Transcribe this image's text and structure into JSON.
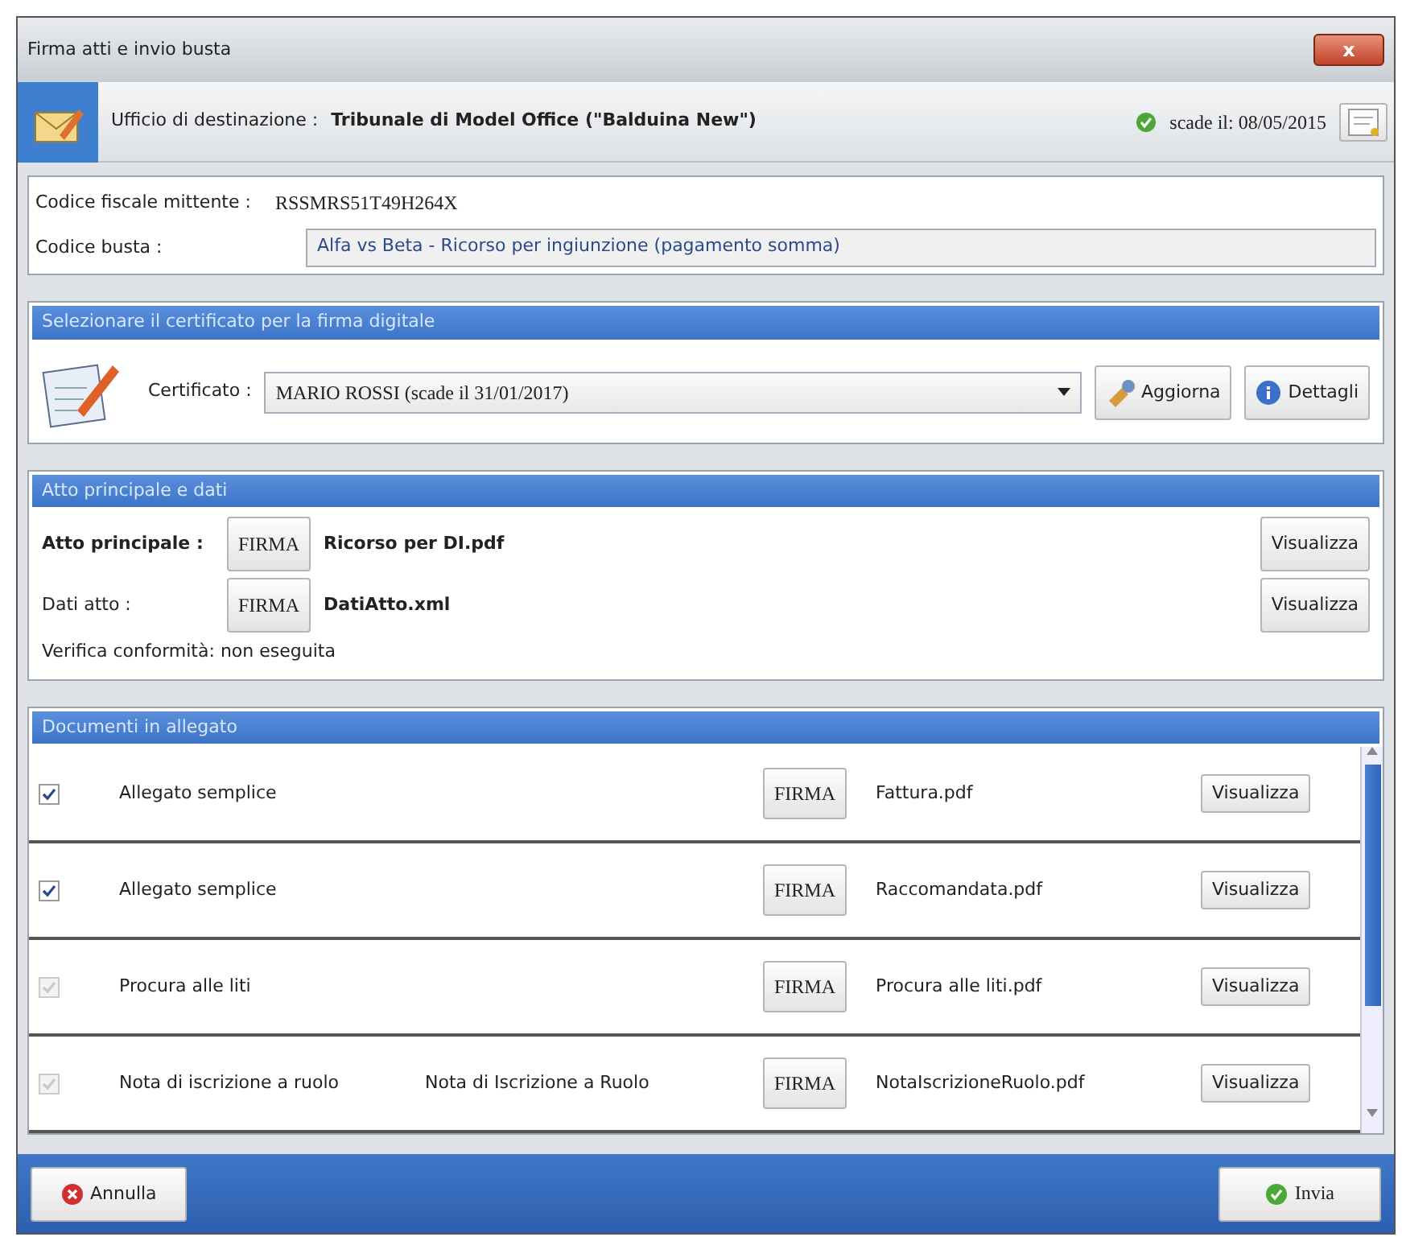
{
  "window": {
    "title": "Firma atti e invio busta",
    "close": "x"
  },
  "header": {
    "label": "Ufficio di destinazione :",
    "value": "Tribunale di Model Office (\"Balduina New\")",
    "expiry": "scade il: 08/05/2015"
  },
  "sender": {
    "fiscal_code_label": "Codice fiscale mittente :",
    "fiscal_code": "RSSMRS51T49H264X",
    "envelope_label": "Codice  busta :",
    "envelope_code": "Alfa vs Beta - Ricorso per ingiunzione (pagamento somma)"
  },
  "certificate": {
    "title": "Selezionare il certificato per la firma digitale",
    "label": "Certificato :",
    "value": "MARIO ROSSI (scade il 31/01/2017)",
    "buttons": [
      "Aggiorna",
      "Dettagli"
    ]
  },
  "main_act": {
    "title": "Atto principale e dati",
    "rows": [
      {
        "label": "Atto principale :",
        "sign": "FIRMA",
        "file": "Ricorso per DI.pdf",
        "view": "Visualizza",
        "bold_label": true
      },
      {
        "label": "Dati atto :",
        "sign": "FIRMA",
        "file": "DatiAtto.xml",
        "view": "Visualizza",
        "bold_label": false
      }
    ],
    "verification": "Verifica conformità: non eseguita"
  },
  "attachments": {
    "title": "Documenti in allegato",
    "rows": [
      {
        "checked": true,
        "disabled": false,
        "type": "Allegato semplice",
        "sign": "FIRMA",
        "file": "Fattura.pdf",
        "view": "Visualizza"
      },
      {
        "checked": true,
        "disabled": false,
        "type": "Allegato semplice",
        "sign": "FIRMA",
        "file": "Raccomandata.pdf",
        "view": "Visualizza"
      },
      {
        "checked": true,
        "disabled": true,
        "type": "Procura alle liti",
        "sign": "FIRMA",
        "file": "Procura alle liti.pdf",
        "view": "Visualizza"
      },
      {
        "checked": true,
        "disabled": true,
        "type": "Nota di iscrizione a ruolo",
        "description": "Nota di Iscrizione a Ruolo",
        "sign": "FIRMA",
        "file": "NotaIscrizioneRuolo.pdf",
        "view": "Visualizza"
      }
    ]
  },
  "footer": {
    "cancel": "Annulla",
    "send": "Invia"
  }
}
